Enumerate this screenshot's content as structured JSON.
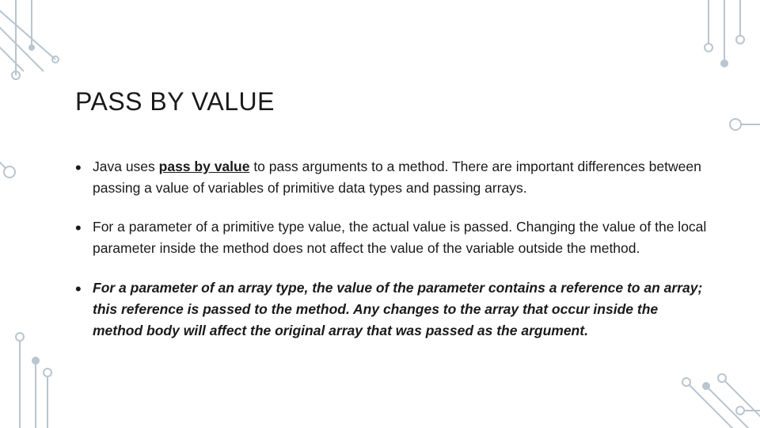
{
  "title": "PASS BY VALUE",
  "bullets": [
    {
      "pre": "Java uses ",
      "em": "pass by value",
      "post": " to pass arguments to a method. There are important differences between passing a value of variables of primitive data types and passing arrays.",
      "style": "underline-bold"
    },
    {
      "text": "For a parameter of a primitive type value, the actual value is passed. Changing the value of the local parameter inside the method does not affect the value of the variable outside the method.",
      "style": "plain"
    },
    {
      "text": "For a parameter of an array type, the value of the parameter contains a reference to an array; this reference is passed to the method. Any changes to the array that occur inside the method body will affect the original array that was passed as the argument.",
      "style": "bold-italic"
    }
  ]
}
